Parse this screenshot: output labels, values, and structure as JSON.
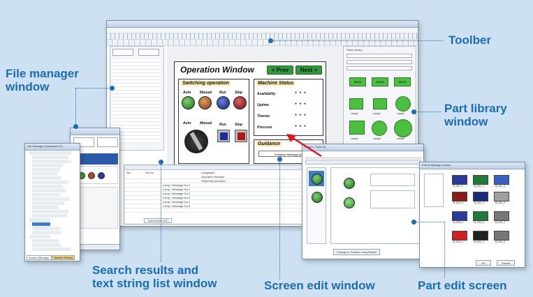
{
  "labels": {
    "toolbar": "Toolber",
    "file_manager": [
      "File manager",
      "window"
    ],
    "part_library": [
      "Part library",
      "window"
    ],
    "search_results": [
      "Search results and",
      "text string list window"
    ],
    "screen_edit": "Screen edit window",
    "part_edit": "Part edit screen"
  },
  "operation_window": {
    "title": "Operation Window",
    "prev": "< Prev",
    "next": "Next >",
    "switching_title": "Switching operation",
    "switch_labels": [
      "Auto",
      "Manual",
      "Run",
      "Stop"
    ],
    "switch_labels2": [
      "Auto",
      "Manual",
      "Run",
      "Stop"
    ],
    "machine_status_title": "Machine Status",
    "status_rows": [
      "Availability",
      "Uptime",
      "Thermo",
      "Pressure"
    ],
    "guidance_title": "Guidance",
    "guidance_text": "Guidance Message.Ipc"
  },
  "file_manager": {
    "header": "File Manager (GraphicsLCF)",
    "items": [
      "All Configuration",
      "Basic Setup",
      "GT Communication Parameters",
      "Clock Setting",
      "Language",
      "Recipe",
      "DS Recipe",
      "Operation Security",
      "Auto Paging",
      "Start-up Screen",
      "SD Card",
      "Hold Device Value",
      "Alarm History",
      "Line Graph",
      "Video Registration",
      "Countdown Timer",
      "Recorder",
      "Event Recorder",
      "Data Logging",
      "Setup File",
      "Recipe List",
      "DS Recipe List",
      "Operation Security Password"
    ],
    "tabs": [
      "Screen Manager",
      "System Setting"
    ]
  },
  "part_library": {
    "title": "Parts Library",
    "buttons": [
      "ABCD",
      "ABCD",
      "ABCD"
    ],
    "captions": [
      "Lamp1",
      "Lamp2",
      "Lamp3",
      "Lamp4",
      "Lamp5",
      "Lamp6"
    ]
  },
  "part_edit": {
    "title": "Edit of Manager Library",
    "captions": [
      "B_001_0",
      "B_001_1",
      "B_001_2",
      "B_002_0",
      "B_002_1",
      "B_002_2",
      "B_003_0",
      "B_003_1",
      "B_003_2",
      "B_004_0",
      "B_004_1",
      "B_004_2"
    ],
    "ok": "OK",
    "cancel": "Cancel",
    "colors": [
      "#2a3a9a",
      "#1f7a3a",
      "#3a5fbf",
      "#8b1a1a",
      "#1b2b7a",
      "#a0a0a0",
      "#cc2222",
      "#222222",
      "#777777"
    ]
  },
  "screen_edit": {
    "title": "Switch / Parts (1)",
    "tabs": [
      "Lamp/Message",
      "Switch",
      "Details",
      "Expansion",
      "Display ON/OFF",
      "Retrieval/Write",
      "Operation Security"
    ],
    "button": "Change to Custom Lamp/Switch"
  },
  "search_results": {
    "columns": [
      "No.",
      "Set for",
      "Language1"
    ],
    "rows": [
      "Operation Window",
      "Switching operation",
      "Lamp / Message No.0",
      "Lamp / Message No.1",
      "Lamp / Message No.2",
      "Lamp / Message No.3",
      "Lamp / Message No.4",
      "Lamp / Message No.5"
    ],
    "footer": "GlobalTable (GT)"
  }
}
